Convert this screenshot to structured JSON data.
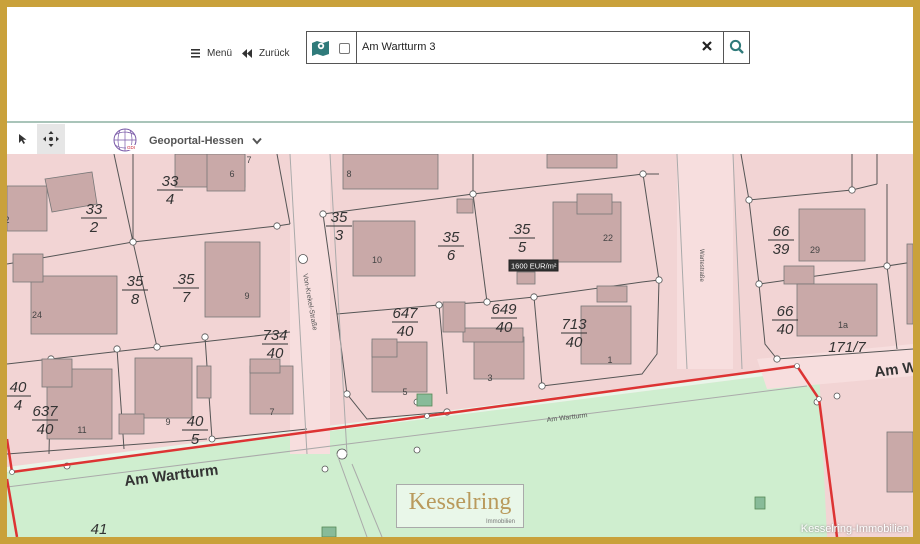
{
  "nav": {
    "menu_label": "Menü",
    "back_label": "Zurück"
  },
  "search": {
    "value": "Am Wartturm 3"
  },
  "toolbar": {
    "portal_name": "Geoportal-Hessen"
  },
  "map": {
    "street_main": "Am Wartturm",
    "street_main_small": "Am Wartturm",
    "street_vertical": "Von-Krekel-Straße",
    "street_vertical2": "Wartestraße",
    "price_label": "1600 EUR/m²",
    "parcels": [
      {
        "num": "33",
        "den": "4"
      },
      {
        "num": "33",
        "den": "2"
      },
      {
        "num": "35",
        "den": "8"
      },
      {
        "num": "35",
        "den": "7"
      },
      {
        "num": "35",
        "den": "3"
      },
      {
        "num": "35",
        "den": "6"
      },
      {
        "num": "35",
        "den": "5"
      },
      {
        "num": "66",
        "den": "39"
      },
      {
        "num": "734",
        "den": "40"
      },
      {
        "num": "647",
        "den": "40"
      },
      {
        "num": "649",
        "den": "40"
      },
      {
        "num": "713",
        "den": "40"
      },
      {
        "num": "66",
        "den": "40"
      },
      {
        "num": "171/7",
        "den": ""
      },
      {
        "num": "40",
        "den": "4"
      },
      {
        "num": "637",
        "den": "40"
      },
      {
        "num": "40",
        "den": "5"
      },
      {
        "num": "41",
        "den": ""
      }
    ],
    "house_numbers": [
      "8",
      "6",
      "7",
      "10",
      "22",
      "29",
      "9",
      "24",
      "5",
      "3",
      "1",
      "1a",
      "11",
      "9",
      "7",
      "2"
    ],
    "street_right": "Am W"
  },
  "watermark": {
    "name": "Kesselring",
    "sub": "Immobilien"
  },
  "credit": "Kesselring-Immobilien"
}
